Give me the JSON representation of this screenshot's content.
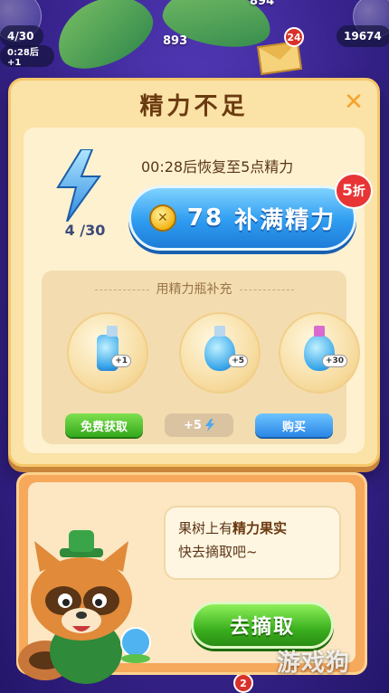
{
  "hud": {
    "energy_pill": "4/30",
    "timer_pill": "0:28后+1",
    "score_top": "894",
    "score_mid": "893",
    "coins": "19674",
    "mail_badge": "24",
    "bottom_badge": "2"
  },
  "dialog": {
    "title": "精力不足",
    "close_icon": "✕",
    "energy_count": "4 /30",
    "recover_text": "00:28后恢复至5点精力",
    "refill": {
      "price": "78",
      "label": "补满精力",
      "discount_number": "5",
      "discount_suffix": "折"
    },
    "bottles": {
      "header": "用精力瓶补充",
      "items": [
        {
          "tag": "+1",
          "button": "免费获取"
        },
        {
          "tag": "+5",
          "button": "+5"
        },
        {
          "tag": "+30",
          "button": "购买"
        }
      ]
    }
  },
  "tree_panel": {
    "line1_prefix": "果树上有",
    "line1_highlight": "精力果实",
    "line2": "快去摘取吧~",
    "button": "去摘取"
  },
  "watermark": "游戏狗"
}
